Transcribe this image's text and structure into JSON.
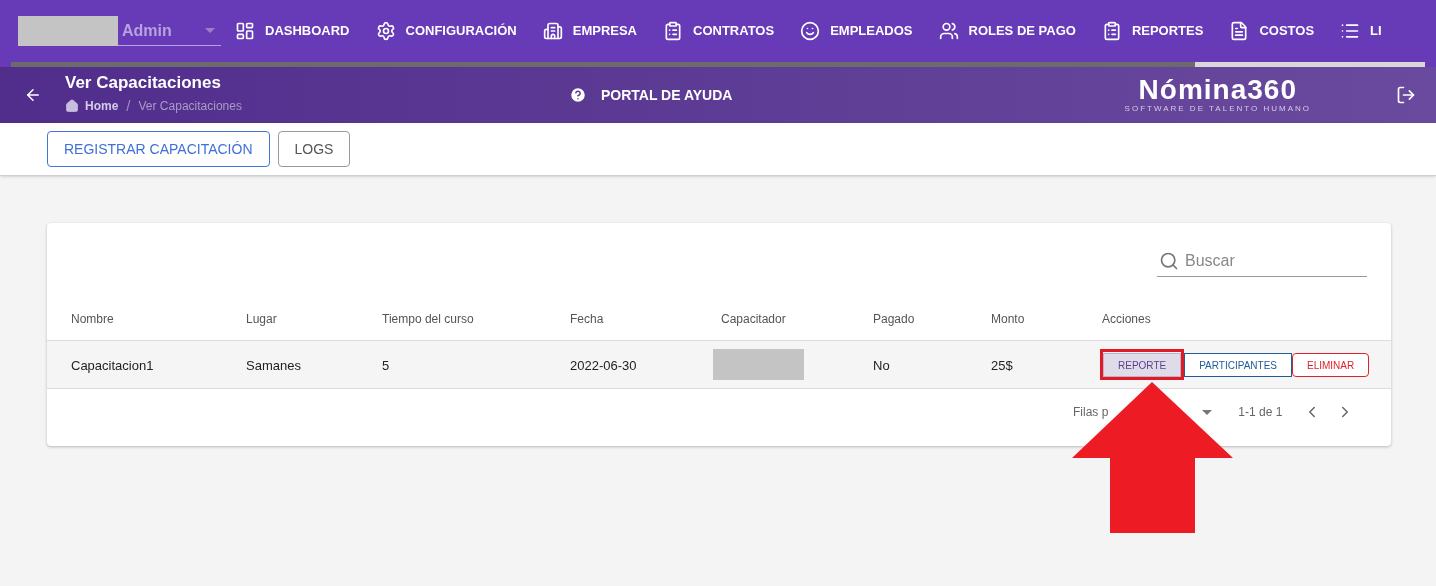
{
  "user_menu": {
    "role": "Admin"
  },
  "nav": [
    {
      "label": "DASHBOARD",
      "kind": "dashboard"
    },
    {
      "label": "CONFIGURACIÓN",
      "kind": "gear"
    },
    {
      "label": "EMPRESA",
      "kind": "building"
    },
    {
      "label": "CONTRATOS",
      "kind": "clipboard"
    },
    {
      "label": "EMPLEADOS",
      "kind": "face"
    },
    {
      "label": "ROLES DE PAGO",
      "kind": "people"
    },
    {
      "label": "REPORTES",
      "kind": "clipboard"
    },
    {
      "label": "COSTOS",
      "kind": "invoice"
    },
    {
      "label": "LI",
      "kind": "list"
    }
  ],
  "header": {
    "title": "Ver Capacitaciones",
    "breadcrumb": [
      "Home",
      "Ver Capacitaciones"
    ],
    "breadcrumb_separator": "/",
    "help": "PORTAL DE AYUDA",
    "logo": "Nómina360",
    "logo_tagline": "SOFTWARE DE TALENTO HUMANO"
  },
  "toolbar": [
    {
      "label": "REGISTRAR CAPACITACIÓN",
      "kind": "primary"
    },
    {
      "label": "LOGS",
      "kind": "default"
    }
  ],
  "search": {
    "placeholder": "Buscar"
  },
  "table": {
    "columns": [
      "Nombre",
      "Lugar",
      "Tiempo del curso",
      "Fecha",
      "Capacitador",
      "Pagado",
      "Monto",
      "Acciones"
    ],
    "rows": [
      {
        "cells": [
          "Capacitacion1",
          "Samanes",
          "5",
          "2022-06-30",
          "",
          "No",
          "25$"
        ],
        "actions": [
          {
            "label": "REPORTE",
            "kind": "report",
            "highlighted": true
          },
          {
            "label": "PARTICIPANTES",
            "kind": "participants",
            "highlighted": false
          },
          {
            "label": "ELIMINAR",
            "kind": "delete",
            "highlighted": false
          }
        ]
      }
    ]
  },
  "pagination": {
    "rows_label": "Filas p",
    "range": "1-1 de 1"
  }
}
